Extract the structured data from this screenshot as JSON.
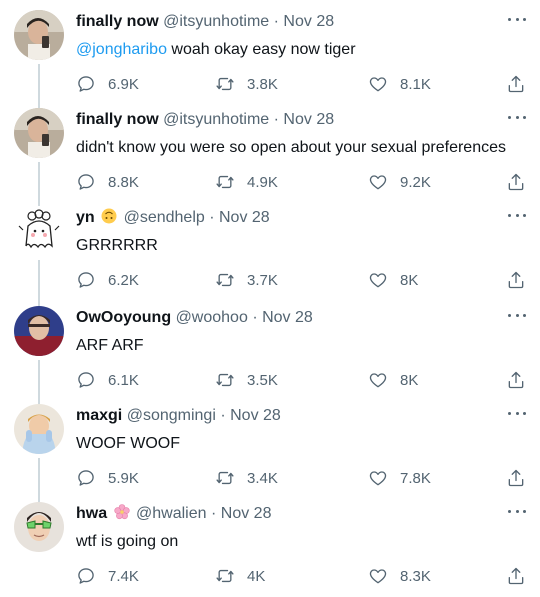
{
  "tweets": [
    {
      "name": "finally now",
      "handle": "@itsyunhotime",
      "sep": "·",
      "date": "Nov 28",
      "mention": "@jongharibo",
      "text": " woah okay easy now tiger",
      "replies": "6.9K",
      "retweets": "3.8K",
      "likes": "8.1K",
      "avatar": "photo-selfie"
    },
    {
      "name": "finally now",
      "handle": "@itsyunhotime",
      "sep": "·",
      "date": "Nov 28",
      "mention": "",
      "text": "didn't know you were so open about your sexual preferences",
      "replies": "8.8K",
      "retweets": "4.9K",
      "likes": "9.2K",
      "avatar": "photo-selfie"
    },
    {
      "name": "yn",
      "handle": "@sendhelp",
      "sep": "·",
      "date": "Nov 28",
      "mention": "",
      "text": "GRRRRRR",
      "replies": "6.2K",
      "retweets": "3.7K",
      "likes": "8K",
      "avatar": "ghost-doodle",
      "badge_emoji": "upside-down-face-emoji"
    },
    {
      "name": "OwOoyoung",
      "handle": "@woohoo",
      "sep": "·",
      "date": "Nov 28",
      "mention": "",
      "text": "ARF ARF",
      "replies": "6.1K",
      "retweets": "3.5K",
      "likes": "8K",
      "avatar": "photo-portrait-dark"
    },
    {
      "name": "maxgi",
      "handle": "@songmingi",
      "sep": "·",
      "date": "Nov 28",
      "mention": "",
      "text": "WOOF WOOF",
      "replies": "5.9K",
      "retweets": "3.4K",
      "likes": "7.8K",
      "avatar": "photo-portrait-light"
    },
    {
      "name": "hwa",
      "handle": "@hwalien",
      "sep": "·",
      "date": "Nov 28",
      "mention": "",
      "text": "wtf is going on",
      "replies": "7.4K",
      "retweets": "4K",
      "likes": "8.3K",
      "avatar": "photo-portrait-glasses",
      "badge_emoji": "cherry-blossom-emoji"
    }
  ],
  "colors": {
    "text": "#0f1419",
    "secondary": "#536471",
    "link": "#1d9bf0",
    "thread_line": "#cfd9de"
  }
}
